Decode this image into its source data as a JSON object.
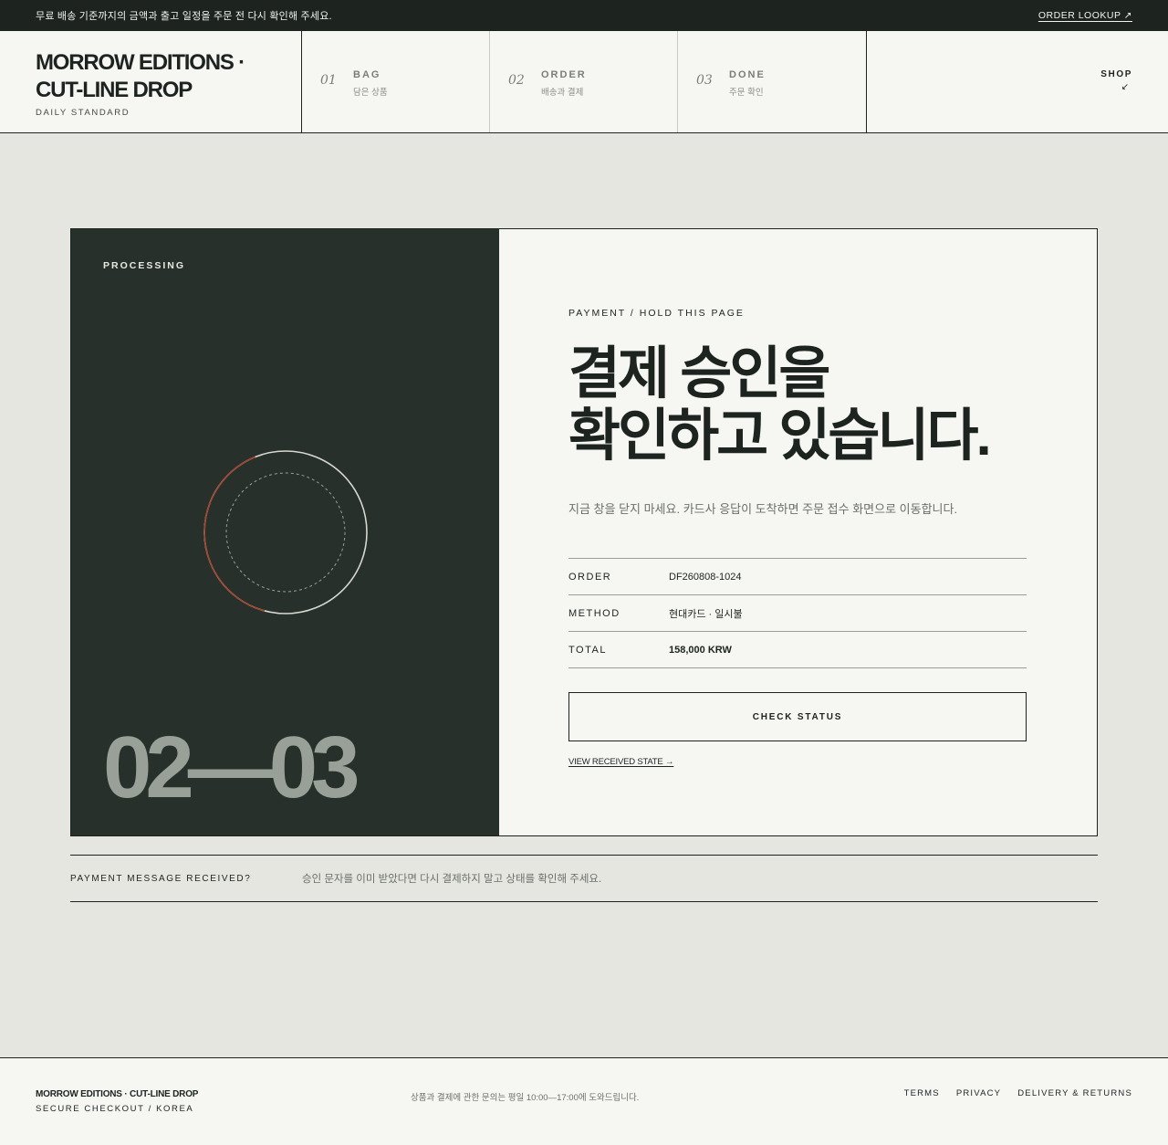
{
  "topbar": {
    "notice": "무료 배송 기준까지의 금액과 출고 일정을 주문 전 다시 확인해 주세요.",
    "lookup": "ORDER LOOKUP ↗"
  },
  "brand": {
    "name": "MORROW EDITIONS · CUT-LINE DROP",
    "subtitle": "DAILY STANDARD"
  },
  "steps": [
    {
      "num": "01",
      "label": "BAG",
      "sub": "담은 상품"
    },
    {
      "num": "02",
      "label": "ORDER",
      "sub": "배송과 결제"
    },
    {
      "num": "03",
      "label": "DONE",
      "sub": "주문 확인"
    }
  ],
  "shop": {
    "label": "SHOP",
    "arrow": "↙"
  },
  "left_panel": {
    "status": "PROCESSING",
    "counter": "02—03",
    "accent_color": "#a0452f"
  },
  "right_panel": {
    "eyebrow": "PAYMENT / HOLD THIS PAGE",
    "headline_1": "결제 승인을",
    "headline_2": "확인하고 있습니다.",
    "description": "지금 창을 닫지 마세요. 카드사 응답이 도착하면 주문 접수 화면으로 이동합니다.",
    "info": [
      {
        "key": "ORDER",
        "value": "DF260808-1024"
      },
      {
        "key": "METHOD",
        "value": "현대카드 · 일시불"
      },
      {
        "key": "TOTAL",
        "value": "158,000 KRW"
      }
    ],
    "button": "CHECK STATUS",
    "link": "VIEW RECEIVED STATE →"
  },
  "message": {
    "key": "PAYMENT MESSAGE RECEIVED?",
    "value": "승인 문자를 이미 받았다면 다시 결제하지 말고 상태를 확인해 주세요."
  },
  "footer": {
    "brand": "MORROW EDITIONS · CUT-LINE DROP",
    "sub": "SECURE CHECKOUT / KOREA",
    "note": "상품과 결제에 관한 문의는 평일 10:00—17:00에 도와드립니다.",
    "links": [
      "TERMS",
      "PRIVACY",
      "DELIVERY & RETURNS"
    ]
  }
}
